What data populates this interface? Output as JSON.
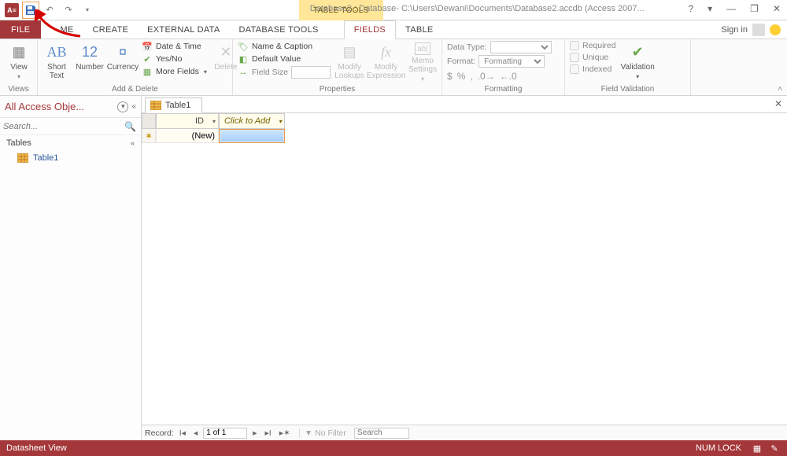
{
  "titlebar": {
    "table_tools": "TABLE TOOLS",
    "title": "Database2 : Database- C:\\Users\\Dewani\\Documents\\Database2.accdb (Access 2007..."
  },
  "menu": {
    "file": "FILE",
    "home": "ME",
    "create": "CREATE",
    "external": "EXTERNAL DATA",
    "dbtools": "DATABASE TOOLS",
    "fields": "FIELDS",
    "table": "TABLE",
    "signin": "Sign in"
  },
  "ribbon": {
    "views": {
      "label": "Views",
      "view": "View"
    },
    "add_delete": {
      "label": "Add & Delete",
      "short_text": "Short\nText",
      "number": "Number",
      "currency": "Currency",
      "date_time": "Date & Time",
      "yes_no": "Yes/No",
      "more_fields": "More Fields",
      "delete": "Delete"
    },
    "properties": {
      "label": "Properties",
      "name_caption": "Name & Caption",
      "default_value": "Default Value",
      "field_size": "Field Size",
      "modify_lookups": "Modify\nLookups",
      "modify_expression": "Modify\nExpression",
      "memo_settings": "Memo\nSettings"
    },
    "formatting": {
      "label": "Formatting",
      "data_type": "Data Type:",
      "format": "Format:",
      "format_value": "Formatting"
    },
    "validation": {
      "label": "Field Validation",
      "required": "Required",
      "unique": "Unique",
      "indexed": "Indexed",
      "validation": "Validation"
    }
  },
  "nav": {
    "header": "All Access Obje...",
    "search_placeholder": "Search...",
    "group": "Tables",
    "table1": "Table1"
  },
  "sheet": {
    "tab": "Table1",
    "col_id": "ID",
    "col_add": "Click to Add",
    "row_new": "(New)"
  },
  "recnav": {
    "label": "Record:",
    "position": "1 of 1",
    "nofilter": "No Filter",
    "search_placeholder": "Search"
  },
  "status": {
    "left": "Datasheet View",
    "numlock": "NUM LOCK"
  }
}
